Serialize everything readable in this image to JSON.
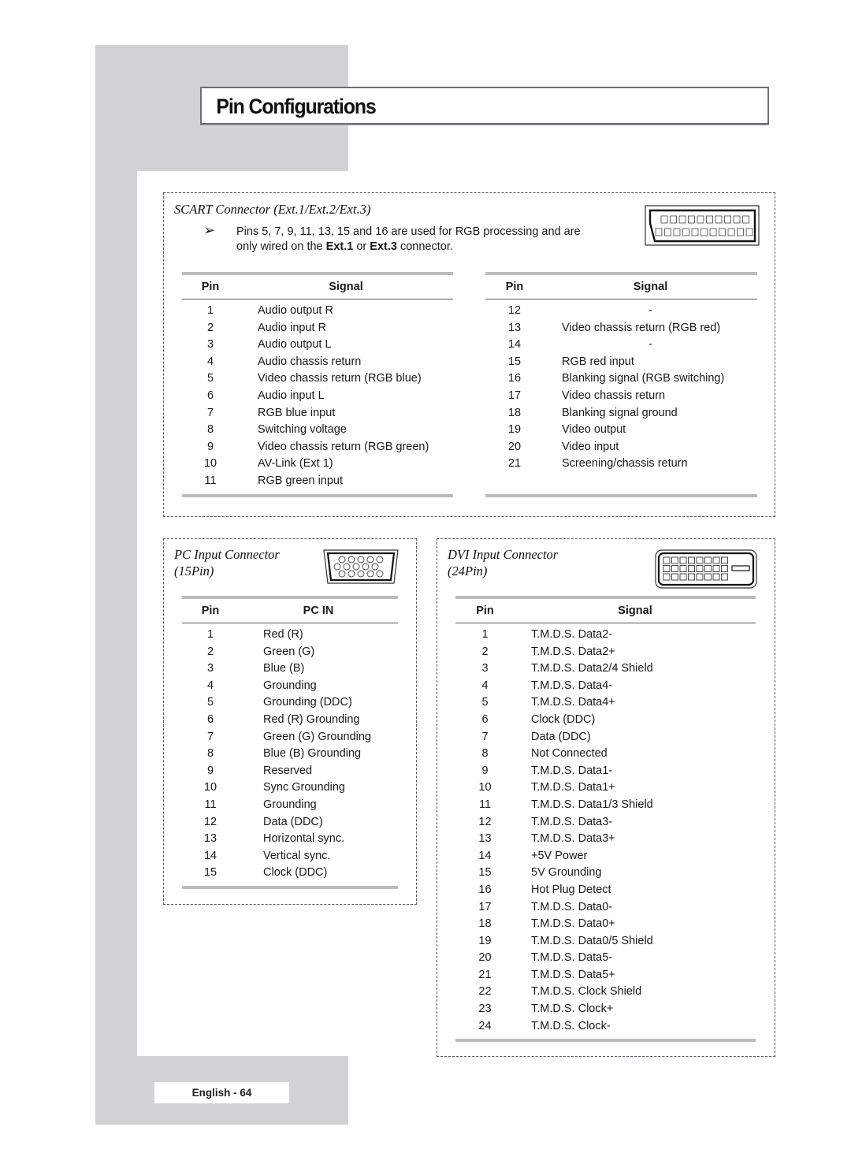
{
  "page": {
    "title": "Pin Configurations",
    "footer": "English - 64"
  },
  "scart": {
    "heading": "SCART Connector (Ext.1/Ext.2/Ext.3)",
    "note_arrow_icon": "arrow-right-icon",
    "note": {
      "line1": "Pins 5, 7, 9, 11, 13, 15 and 16 are used for RGB processing and are",
      "line2_pre": "only wired on the ",
      "line2_b1": "Ext.1",
      "line2_mid": " or ",
      "line2_b2": "Ext.3",
      "line2_post": " connector."
    },
    "connector_icon": "scart-connector-icon",
    "headers": {
      "pin": "Pin",
      "signal": "Signal"
    },
    "left_rows": [
      {
        "pin": "1",
        "signal": "Audio output R"
      },
      {
        "pin": "2",
        "signal": "Audio input R"
      },
      {
        "pin": "3",
        "signal": "Audio output L"
      },
      {
        "pin": "4",
        "signal": "Audio chassis return"
      },
      {
        "pin": "5",
        "signal": "Video chassis return (RGB blue)"
      },
      {
        "pin": "6",
        "signal": "Audio input L"
      },
      {
        "pin": "7",
        "signal": "RGB blue input"
      },
      {
        "pin": "8",
        "signal": "Switching voltage"
      },
      {
        "pin": "9",
        "signal": "Video chassis return (RGB green)"
      },
      {
        "pin": "10",
        "signal": "AV-Link (Ext 1)"
      },
      {
        "pin": "11",
        "signal": "RGB green input"
      }
    ],
    "right_rows": [
      {
        "pin": "12",
        "signal": "-"
      },
      {
        "pin": "13",
        "signal": "Video chassis return (RGB red)"
      },
      {
        "pin": "14",
        "signal": "-"
      },
      {
        "pin": "15",
        "signal": "RGB red input"
      },
      {
        "pin": "16",
        "signal": "Blanking signal (RGB switching)"
      },
      {
        "pin": "17",
        "signal": "Video chassis return"
      },
      {
        "pin": "18",
        "signal": "Blanking signal ground"
      },
      {
        "pin": "19",
        "signal": "Video output"
      },
      {
        "pin": "20",
        "signal": "Video input"
      },
      {
        "pin": "21",
        "signal": "Screening/chassis return"
      }
    ]
  },
  "pc": {
    "heading_line1": "PC Input Connector",
    "heading_line2": "(15Pin)",
    "connector_icon": "vga-connector-icon",
    "headers": {
      "pin": "Pin",
      "signal": "PC IN"
    },
    "rows": [
      {
        "pin": "1",
        "signal": "Red (R)"
      },
      {
        "pin": "2",
        "signal": "Green (G)"
      },
      {
        "pin": "3",
        "signal": "Blue (B)"
      },
      {
        "pin": "4",
        "signal": "Grounding"
      },
      {
        "pin": "5",
        "signal": "Grounding (DDC)"
      },
      {
        "pin": "6",
        "signal": "Red (R) Grounding"
      },
      {
        "pin": "7",
        "signal": "Green (G) Grounding"
      },
      {
        "pin": "8",
        "signal": "Blue (B) Grounding"
      },
      {
        "pin": "9",
        "signal": "Reserved"
      },
      {
        "pin": "10",
        "signal": "Sync Grounding"
      },
      {
        "pin": "11",
        "signal": "Grounding"
      },
      {
        "pin": "12",
        "signal": "Data (DDC)"
      },
      {
        "pin": "13",
        "signal": "Horizontal sync."
      },
      {
        "pin": "14",
        "signal": "Vertical sync."
      },
      {
        "pin": "15",
        "signal": "Clock (DDC)"
      }
    ]
  },
  "dvi": {
    "heading_line1": "DVI Input Connector",
    "heading_line2": "(24Pin)",
    "connector_icon": "dvi-connector-icon",
    "headers": {
      "pin": "Pin",
      "signal": "Signal"
    },
    "rows": [
      {
        "pin": "1",
        "signal": "T.M.D.S. Data2-"
      },
      {
        "pin": "2",
        "signal": "T.M.D.S. Data2+"
      },
      {
        "pin": "3",
        "signal": "T.M.D.S. Data2/4 Shield"
      },
      {
        "pin": "4",
        "signal": "T.M.D.S. Data4-"
      },
      {
        "pin": "5",
        "signal": "T.M.D.S. Data4+"
      },
      {
        "pin": "6",
        "signal": "Clock (DDC)"
      },
      {
        "pin": "7",
        "signal": "Data (DDC)"
      },
      {
        "pin": "8",
        "signal": "Not Connected"
      },
      {
        "pin": "9",
        "signal": "T.M.D.S. Data1-"
      },
      {
        "pin": "10",
        "signal": "T.M.D.S. Data1+"
      },
      {
        "pin": "11",
        "signal": "T.M.D.S. Data1/3 Shield"
      },
      {
        "pin": "12",
        "signal": "T.M.D.S. Data3-"
      },
      {
        "pin": "13",
        "signal": "T.M.D.S. Data3+"
      },
      {
        "pin": "14",
        "signal": "+5V Power"
      },
      {
        "pin": "15",
        "signal": "5V Grounding"
      },
      {
        "pin": "16",
        "signal": "Hot Plug Detect"
      },
      {
        "pin": "17",
        "signal": "T.M.D.S. Data0-"
      },
      {
        "pin": "18",
        "signal": "T.M.D.S. Data0+"
      },
      {
        "pin": "19",
        "signal": "T.M.D.S. Data0/5 Shield"
      },
      {
        "pin": "20",
        "signal": "T.M.D.S. Data5-"
      },
      {
        "pin": "21",
        "signal": "T.M.D.S. Data5+"
      },
      {
        "pin": "22",
        "signal": "T.M.D.S. Clock Shield"
      },
      {
        "pin": "23",
        "signal": "T.M.D.S. Clock+"
      },
      {
        "pin": "24",
        "signal": "T.M.D.S. Clock-"
      }
    ]
  }
}
